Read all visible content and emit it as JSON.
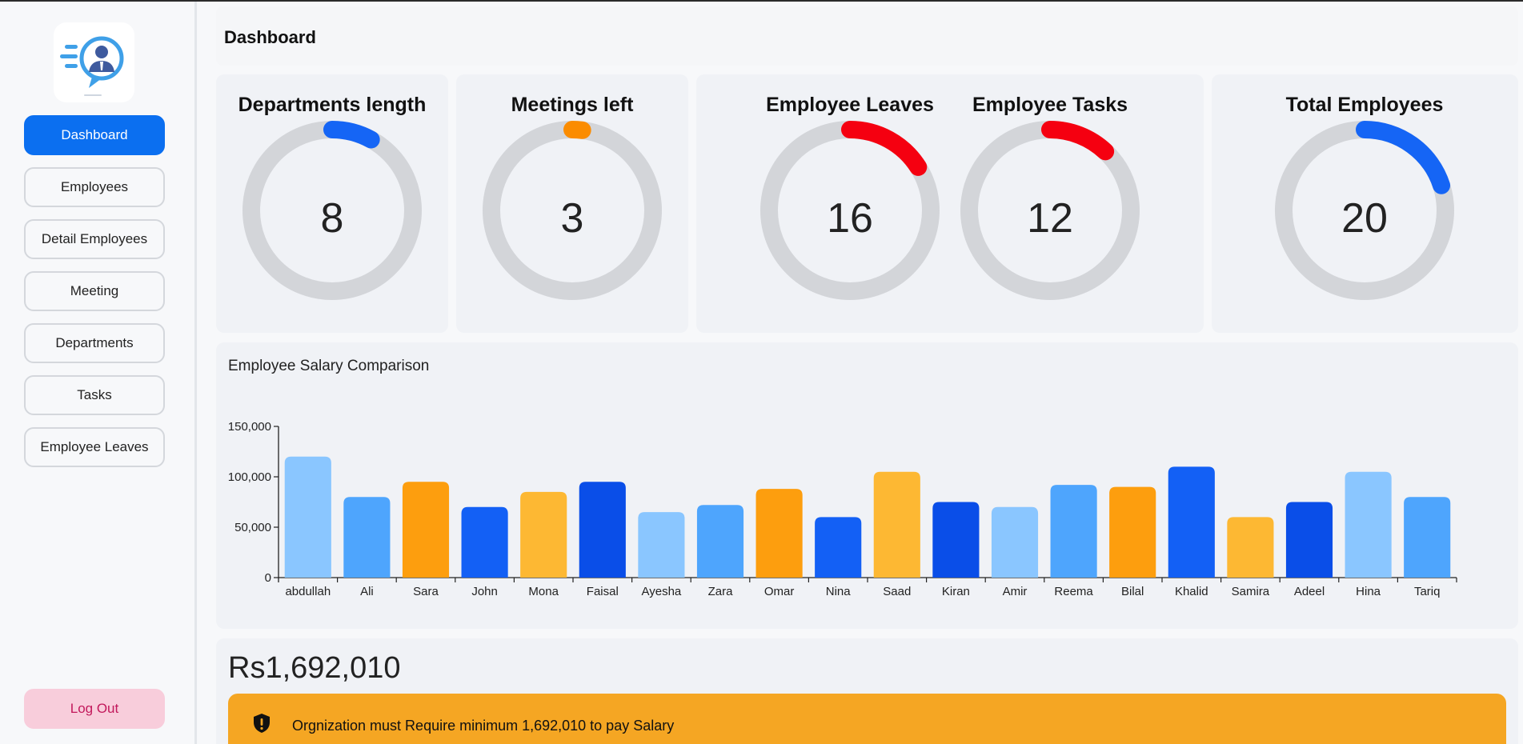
{
  "header": {
    "title": "Dashboard"
  },
  "sidebar": {
    "logo_icon": "employee-logo-icon",
    "items": [
      {
        "label": "Dashboard",
        "active": true
      },
      {
        "label": "Employees"
      },
      {
        "label": "Detail Employees"
      },
      {
        "label": "Meeting"
      },
      {
        "label": "Departments"
      },
      {
        "label": "Tasks"
      },
      {
        "label": "Employee Leaves"
      }
    ],
    "logout_label": "Log Out"
  },
  "stats": [
    {
      "title": "Departments length",
      "value": "8",
      "progress": 0.08,
      "color": "#1565f5"
    },
    {
      "title": "Meetings left",
      "value": "3",
      "progress": 0.02,
      "color": "#fb8c00"
    },
    {
      "title": "Employee Leaves",
      "value": "16",
      "progress": 0.16,
      "color": "#f50010"
    },
    {
      "title": "Employee Tasks",
      "value": "12",
      "progress": 0.12,
      "color": "#f50010"
    },
    {
      "title": "Total Employees",
      "value": "20",
      "progress": 0.2,
      "color": "#1565f5"
    }
  ],
  "chart_data": {
    "type": "bar",
    "title": "Employee Salary Comparison",
    "categories": [
      "abdullah",
      "Ali",
      "Sara",
      "John",
      "Mona",
      "Faisal",
      "Ayesha",
      "Zara",
      "Omar",
      "Nina",
      "Saad",
      "Kiran",
      "Amir",
      "Reema",
      "Bilal",
      "Khalid",
      "Samira",
      "Adeel",
      "Hina",
      "Tariq"
    ],
    "values": [
      120000,
      80000,
      95000,
      70000,
      85000,
      95000,
      65000,
      72000,
      88000,
      60000,
      105000,
      75000,
      70000,
      92000,
      90000,
      110000,
      60000,
      75000,
      105000,
      80000
    ],
    "bar_colors": [
      "#8ac6ff",
      "#4ea5fd",
      "#fd9e0e",
      "#1360f5",
      "#fdb833",
      "#0a4ee8",
      "#8ac6ff",
      "#4ea5fd",
      "#fd9e0e",
      "#1360f5",
      "#fdb833",
      "#0a4ee8",
      "#8ac6ff",
      "#4ea5fd",
      "#fd9e0e",
      "#1360f5",
      "#fdb833",
      "#0a4ee8",
      "#8ac6ff",
      "#4ea5fd"
    ],
    "yticks": [
      "0",
      "50,000",
      "100,000",
      "150,000"
    ],
    "ylim": [
      0,
      150000
    ],
    "xlabel": "",
    "ylabel": ""
  },
  "total": {
    "amount": "Rs1,692,010"
  },
  "warning": {
    "icon": "shield-alert-icon",
    "text": "Orgnization must Require minimum 1,692,010 to pay Salary"
  }
}
